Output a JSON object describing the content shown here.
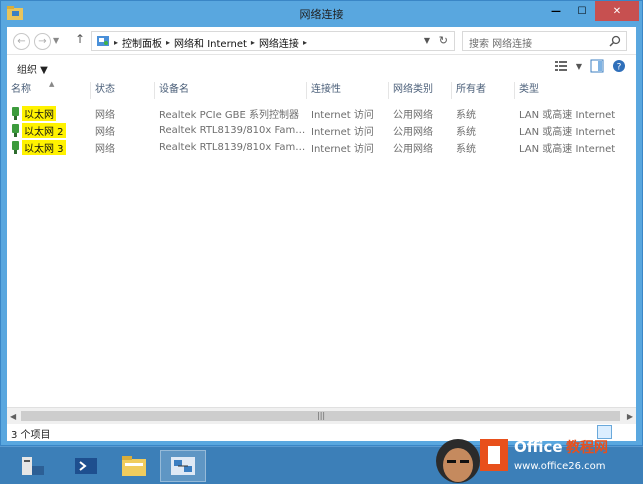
{
  "window": {
    "title": "网络连接",
    "caption": {
      "minimize": "—",
      "maximize": "☐",
      "close": "✕"
    }
  },
  "nav": {
    "back": "←",
    "forward": "→",
    "dropdown": "▼",
    "up": "↑",
    "breadcrumb": [
      "控制面板",
      "网络和 Internet",
      "网络连接"
    ],
    "separator": "▸",
    "refresh": "↻",
    "search_placeholder": "搜索 网络连接"
  },
  "toolbar": {
    "organize_label": "组织 ▼"
  },
  "columns": [
    {
      "key": "name",
      "label": "名称"
    },
    {
      "key": "status",
      "label": "状态"
    },
    {
      "key": "device",
      "label": "设备名"
    },
    {
      "key": "connectivity",
      "label": "连接性"
    },
    {
      "key": "category",
      "label": "网络类别"
    },
    {
      "key": "owner",
      "label": "所有者"
    },
    {
      "key": "type",
      "label": "类型"
    }
  ],
  "sort_indicator": "▲",
  "rows": [
    {
      "name": "以太网",
      "status": "网络",
      "device": "Realtek PCIe GBE 系列控制器",
      "connectivity": "Internet 访问",
      "category": "公用网络",
      "owner": "系统",
      "type": "LAN 或高速 Internet"
    },
    {
      "name": "以太网 2",
      "status": "网络",
      "device": "Realtek RTL8139/810x Family...",
      "connectivity": "Internet 访问",
      "category": "公用网络",
      "owner": "系统",
      "type": "LAN 或高速 Internet"
    },
    {
      "name": "以太网 3",
      "status": "网络",
      "device": "Realtek RTL8139/810x Family...",
      "connectivity": "Internet 访问",
      "category": "公用网络",
      "owner": "系统",
      "type": "LAN 或高速 Internet"
    }
  ],
  "scroll": {
    "left": "◀",
    "right": "▶",
    "grip": "|||"
  },
  "status": {
    "item_count": "3 个项目"
  },
  "taskbar": {
    "apps": [
      "server-manager",
      "powershell",
      "file-explorer",
      "network-connections"
    ]
  },
  "watermark": {
    "brand": "Office教程网",
    "url": "www.office26.com"
  },
  "colors": {
    "accent": "#59a7df",
    "highlight": "#fff200",
    "taskbar": "#3c7fb8"
  }
}
